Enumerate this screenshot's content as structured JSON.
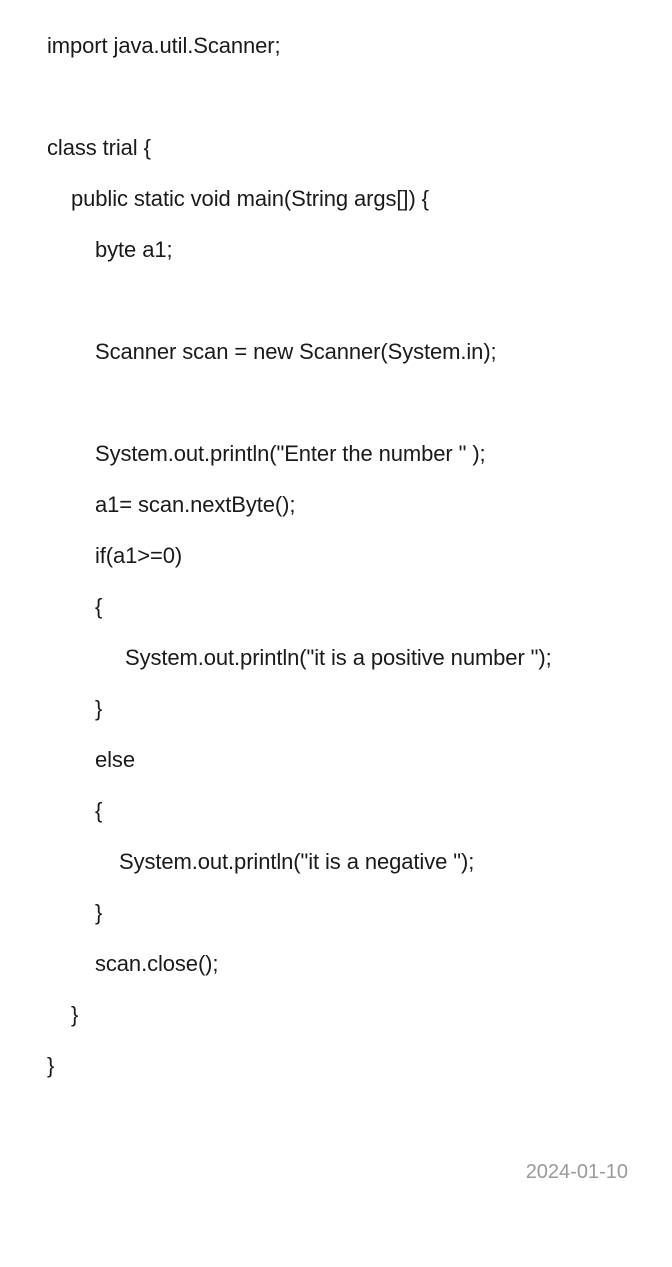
{
  "note": {
    "lines": [
      "import java.util.Scanner;",
      "class trial {",
      "public static void main(String args[]) {",
      "byte a1;",
      "Scanner scan = new Scanner(System.in);",
      "System.out.println(\"Enter the number \" );",
      "a1= scan.nextByte();",
      "if(a1>=0)",
      "{",
      "System.out.println(\"it is a positive number \");",
      "}",
      "else",
      "{",
      "System.out.println(\"it is a negative \");",
      "}",
      "scan.close();",
      "}",
      "}"
    ],
    "date": "2024-01-10"
  }
}
